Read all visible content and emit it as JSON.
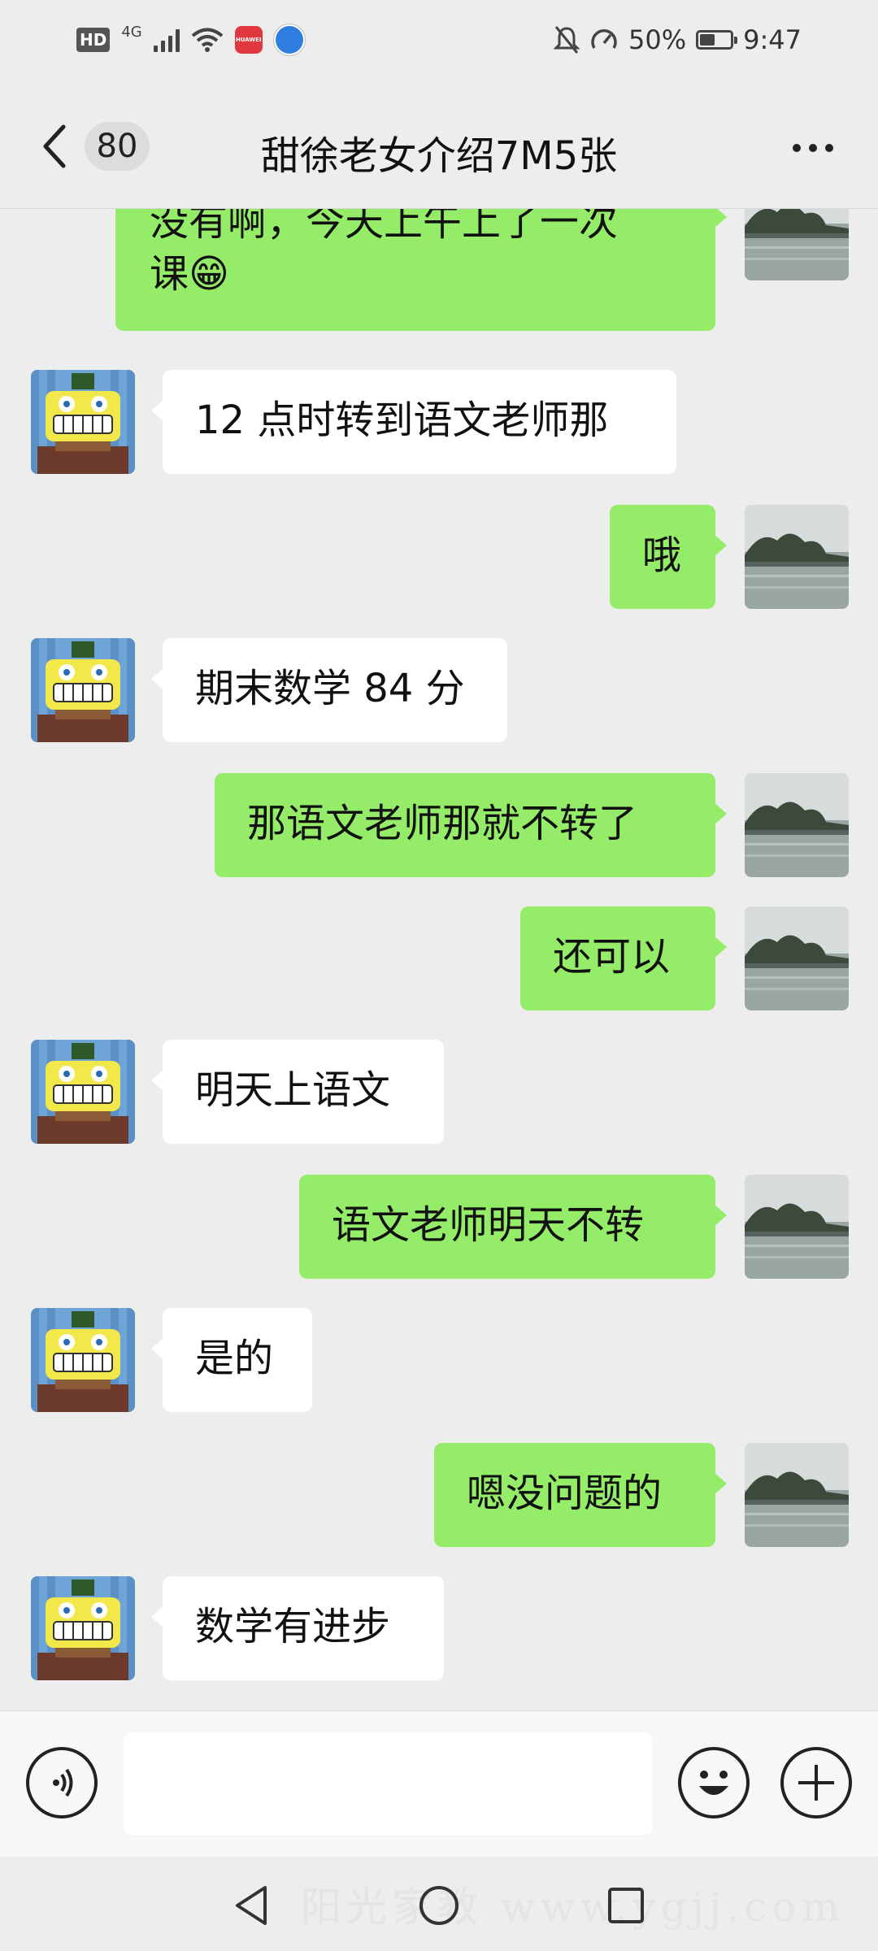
{
  "status_bar": {
    "hd": "HD",
    "network": "4G",
    "app_icon_text": "HUAWEI",
    "battery": "50%",
    "time": "9:47"
  },
  "header": {
    "unread_count": "80",
    "title": "甜徐老女介绍7M5张"
  },
  "messages": [
    {
      "sender": "me",
      "lines": [
        "没有啊，今天上午上了一次",
        "课😁"
      ]
    },
    {
      "sender": "them",
      "lines": [
        "12 点时转到语文老师那"
      ]
    },
    {
      "sender": "me",
      "lines": [
        "哦"
      ]
    },
    {
      "sender": "them",
      "lines": [
        "期末数学 84 分"
      ]
    },
    {
      "sender": "me",
      "lines": [
        "那语文老师那就不转了"
      ]
    },
    {
      "sender": "me",
      "lines": [
        "还可以"
      ]
    },
    {
      "sender": "them",
      "lines": [
        "明天上语文"
      ]
    },
    {
      "sender": "me",
      "lines": [
        "语文老师明天不转"
      ]
    },
    {
      "sender": "them",
      "lines": [
        "是的"
      ]
    },
    {
      "sender": "me",
      "lines": [
        "嗯没问题的"
      ]
    },
    {
      "sender": "them",
      "lines": [
        "数学有进步"
      ]
    }
  ],
  "input": {
    "value": "",
    "placeholder": ""
  },
  "navigation": {
    "watermark": "阳光家教 www.ygjj.com"
  },
  "colors": {
    "background": "#ededed",
    "my_bubble": "#95ec69",
    "their_bubble": "#ffffff"
  },
  "icons": {
    "back": "chevron-left-icon",
    "more": "more-dots-icon",
    "voice": "voice-icon",
    "emoji": "emoji-icon",
    "plus": "plus-icon"
  }
}
